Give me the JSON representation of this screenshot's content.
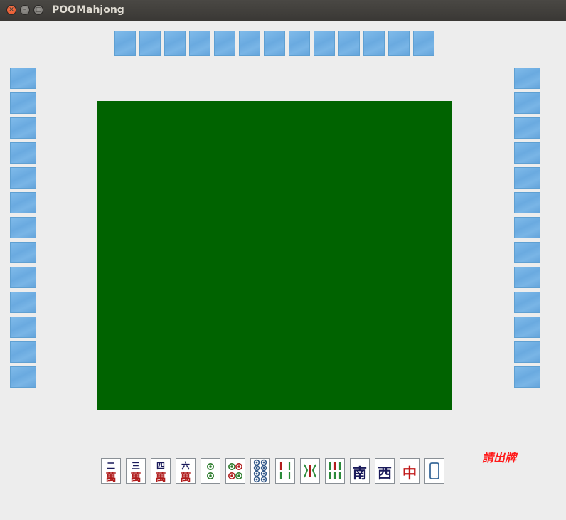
{
  "window": {
    "title": "POOMahjong"
  },
  "status_text": "請出牌",
  "opponents": {
    "top": {
      "tile_count": 13
    },
    "left": {
      "tile_count": 13
    },
    "right": {
      "tile_count": 13
    }
  },
  "hand": [
    {
      "name": "二萬",
      "top": "二",
      "bottom": "萬",
      "kind": "character"
    },
    {
      "name": "三萬",
      "top": "三",
      "bottom": "萬",
      "kind": "character"
    },
    {
      "name": "四萬",
      "top": "四",
      "bottom": "萬",
      "kind": "character"
    },
    {
      "name": "六萬",
      "top": "六",
      "bottom": "萬",
      "kind": "character"
    },
    {
      "name": "二筒",
      "kind": "circle",
      "count": 2
    },
    {
      "name": "四筒",
      "kind": "circle",
      "count": 4
    },
    {
      "name": "八筒",
      "kind": "circle",
      "count": 8
    },
    {
      "name": "四條",
      "kind": "bamboo",
      "count": 4
    },
    {
      "name": "五條",
      "kind": "bamboo",
      "count": 5
    },
    {
      "name": "六條",
      "kind": "bamboo",
      "count": 6
    },
    {
      "name": "南",
      "top": "南",
      "kind": "wind"
    },
    {
      "name": "西",
      "top": "西",
      "kind": "wind"
    },
    {
      "name": "中",
      "top": "中",
      "kind": "dragon"
    },
    {
      "name": "白板",
      "kind": "white"
    }
  ],
  "colors": {
    "table": "#006300",
    "tile_back": "#72afe3",
    "status": "#ff1a1a",
    "wan_red": "#b01c1c",
    "navy": "#1a1a5a"
  }
}
